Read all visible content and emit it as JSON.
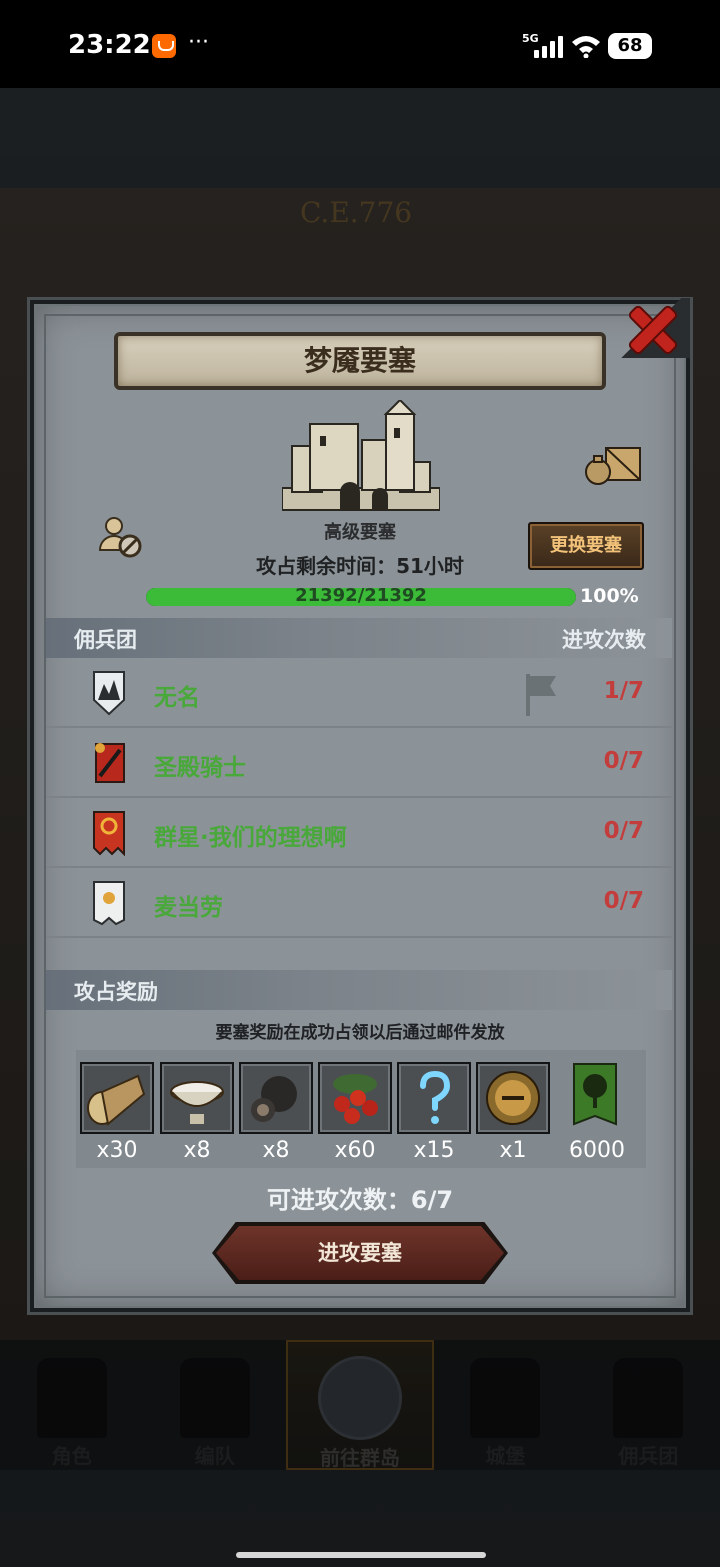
{
  "status_bar": {
    "time": "23:22",
    "more": "···",
    "network": "5G",
    "battery": "68"
  },
  "background": {
    "era_label": "C.E.776"
  },
  "dialog": {
    "title": "梦魇要塞",
    "fortress_type": "高级要塞",
    "switch_button": "更换要塞",
    "timer_label": "攻占剩余时间：51小时",
    "hp_text": "21392/21392",
    "hp_percent": "100%",
    "hp_fraction": 1.0,
    "mercenary_header": "佣兵团",
    "attacks_header": "进攻次数",
    "mercenaries": [
      {
        "name": "无名",
        "count": "1/7",
        "emblem": "mountain-shield-icon"
      },
      {
        "name": "圣殿骑士",
        "count": "0/7",
        "emblem": "crossbow-banner-icon"
      },
      {
        "name": "群星·我们的理想啊",
        "count": "0/7",
        "emblem": "sun-banner-icon"
      },
      {
        "name": "麦当劳",
        "count": "0/7",
        "emblem": "sun-flag-icon"
      }
    ],
    "reward_header": "攻占奖励",
    "reward_note": "要塞奖励在成功占领以后通过邮件发放",
    "rewards": [
      {
        "icon": "wood-log-icon",
        "qty": "x30"
      },
      {
        "icon": "milk-bowl-icon",
        "qty": "x8"
      },
      {
        "icon": "truffle-icon",
        "qty": "x8"
      },
      {
        "icon": "berries-icon",
        "qty": "x60"
      },
      {
        "icon": "question-mark-icon",
        "qty": "x15"
      },
      {
        "icon": "knight-helmet-icon",
        "qty": "x1"
      },
      {
        "icon": "tree-banner-icon",
        "qty": "6000"
      }
    ],
    "attacks_left": "可进攻次数：6/7",
    "attack_button": "进攻要塞"
  },
  "bottom_nav": [
    {
      "label": "角色"
    },
    {
      "label": "编队"
    },
    {
      "label": "前往群岛"
    },
    {
      "label": "城堡"
    },
    {
      "label": "佣兵团"
    }
  ],
  "colors": {
    "merc_name": "#49a83a",
    "attack_count": "#c33d3d",
    "hp_bar": "#3cbb39",
    "switch_button_text": "#f2c27a"
  }
}
